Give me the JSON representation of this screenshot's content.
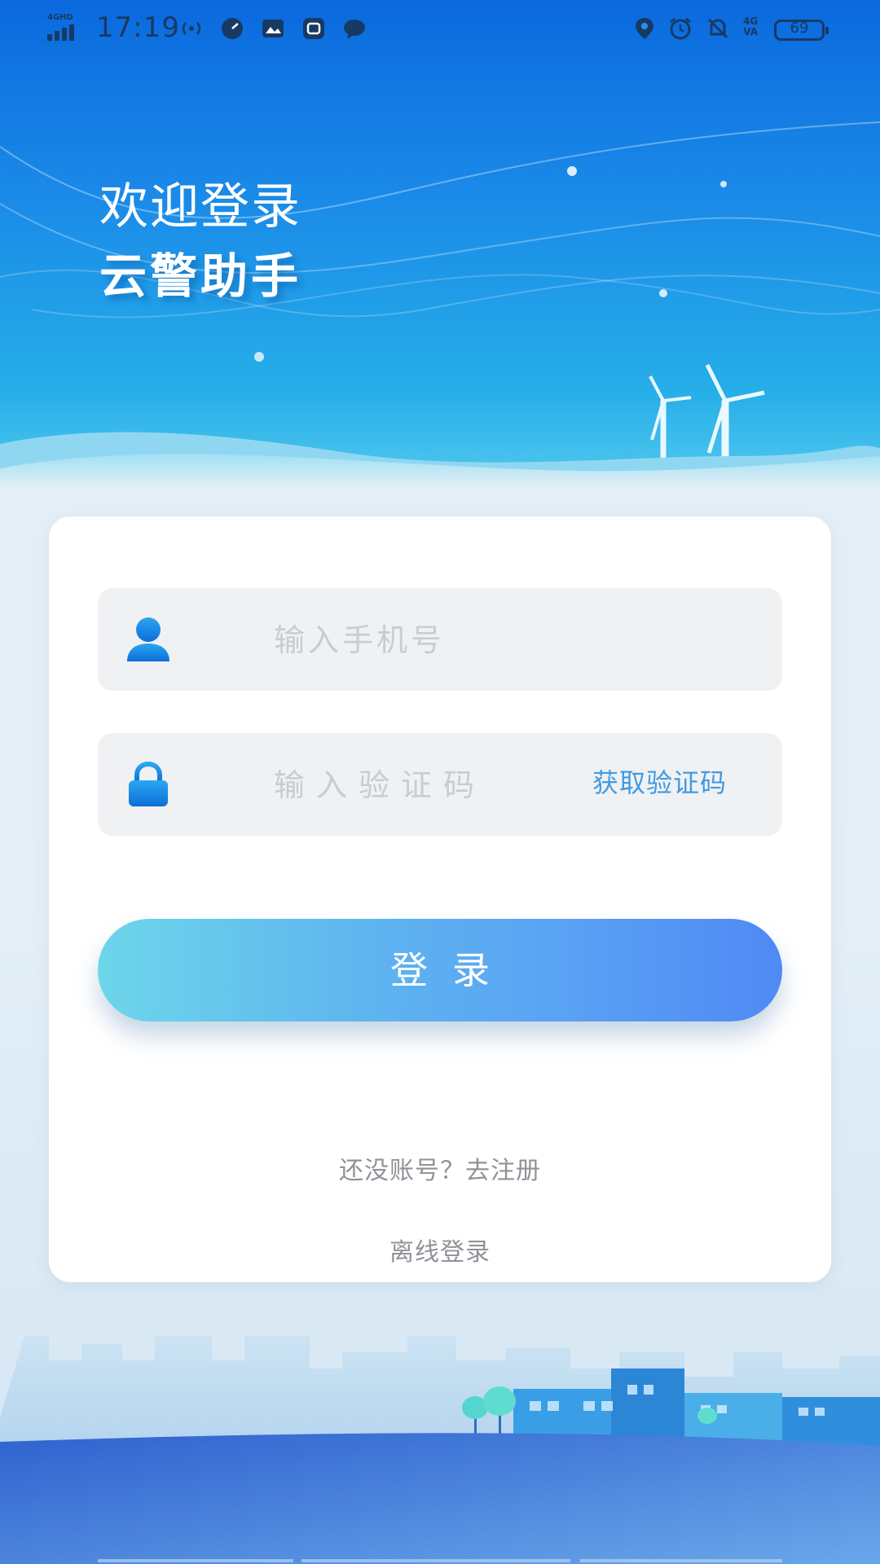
{
  "status_bar": {
    "network_tag": "4GHD",
    "time": "17:19",
    "lte_tag": "4G",
    "lte_sub": "VA",
    "battery": "69",
    "icons_left": [
      "hotspot-icon",
      "speedometer-icon",
      "gallery-icon",
      "app-icon",
      "message-icon"
    ],
    "icons_right": [
      "location-icon",
      "alarm-icon",
      "mute-icon"
    ]
  },
  "hero": {
    "welcome": "欢迎登录",
    "app_name": "云警助手"
  },
  "form": {
    "phone_placeholder": "输入手机号",
    "code_placeholder": "输入验证码",
    "get_code_label": "获取验证码",
    "login_label": "登录",
    "register_link": "还没账号？去注册",
    "offline_link": "离线登录"
  },
  "colors": {
    "brand_blue": "#0b69de",
    "accent": "#3f9be3",
    "button_start": "#6dd6ea",
    "button_end": "#5089f5"
  }
}
